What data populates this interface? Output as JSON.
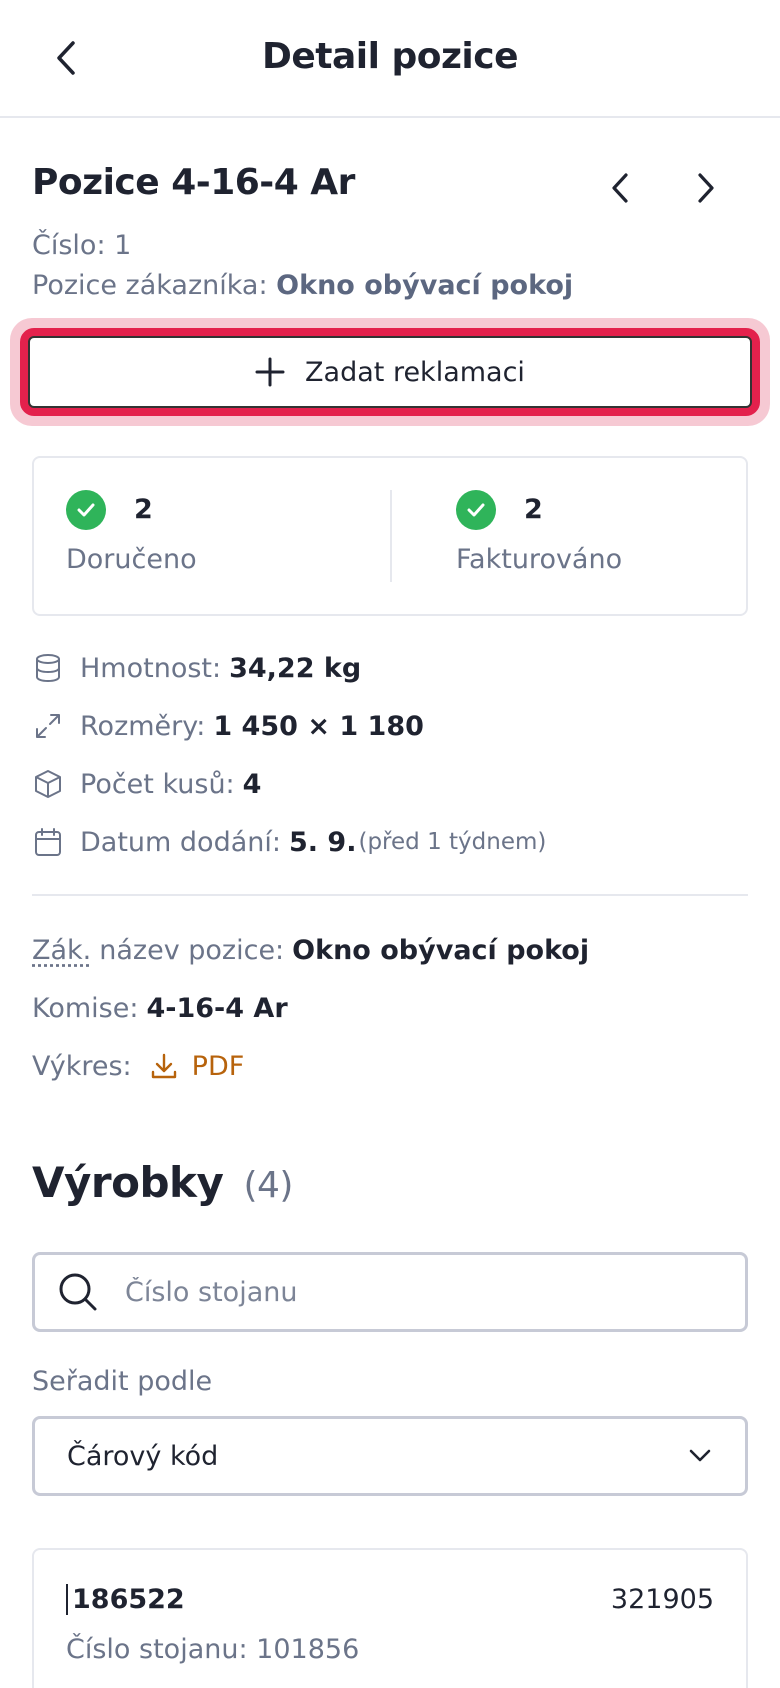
{
  "header": {
    "title": "Detail pozice"
  },
  "position": {
    "title": "Pozice 4-16-4 Ar",
    "number_label": "Číslo:",
    "number_value": "1",
    "customer_label": "Pozice zákazníka:",
    "customer_value": "Okno obývací pokoj"
  },
  "claim_button": {
    "label": "Zadat reklamaci"
  },
  "status": {
    "delivered": {
      "count": "2",
      "label": "Doručeno"
    },
    "invoiced": {
      "count": "2",
      "label": "Fakturováno"
    }
  },
  "specs": {
    "weight": {
      "label": "Hmotnost:",
      "value": "34,22 kg"
    },
    "dimensions": {
      "label": "Rozměry:",
      "value": "1 450 × 1 180"
    },
    "pieces": {
      "label": "Počet kusů:",
      "value": "4"
    },
    "delivery": {
      "label": "Datum dodání:",
      "value": "5. 9.",
      "relative": "(před 1 týdnem)"
    }
  },
  "details": {
    "customer_name_abbr": "Zák.",
    "customer_name_label": "název pozice:",
    "customer_name_value": "Okno obývací pokoj",
    "commission_label": "Komise:",
    "commission_value": "4-16-4 Ar",
    "drawing_label": "Výkres:",
    "drawing_link": "PDF"
  },
  "products": {
    "title": "Výrobky",
    "count": "(4)",
    "search_placeholder": "Číslo stojanu",
    "sort_label": "Seřadit podle",
    "sort_value": "Čárový kód",
    "items": [
      {
        "code": "186522",
        "number": "321905",
        "rack_label": "Číslo stojanu:",
        "rack_value": "101856"
      }
    ]
  },
  "colors": {
    "accent_red": "#e3214c",
    "success_green": "#2fb45a",
    "link_orange": "#b7630c"
  }
}
